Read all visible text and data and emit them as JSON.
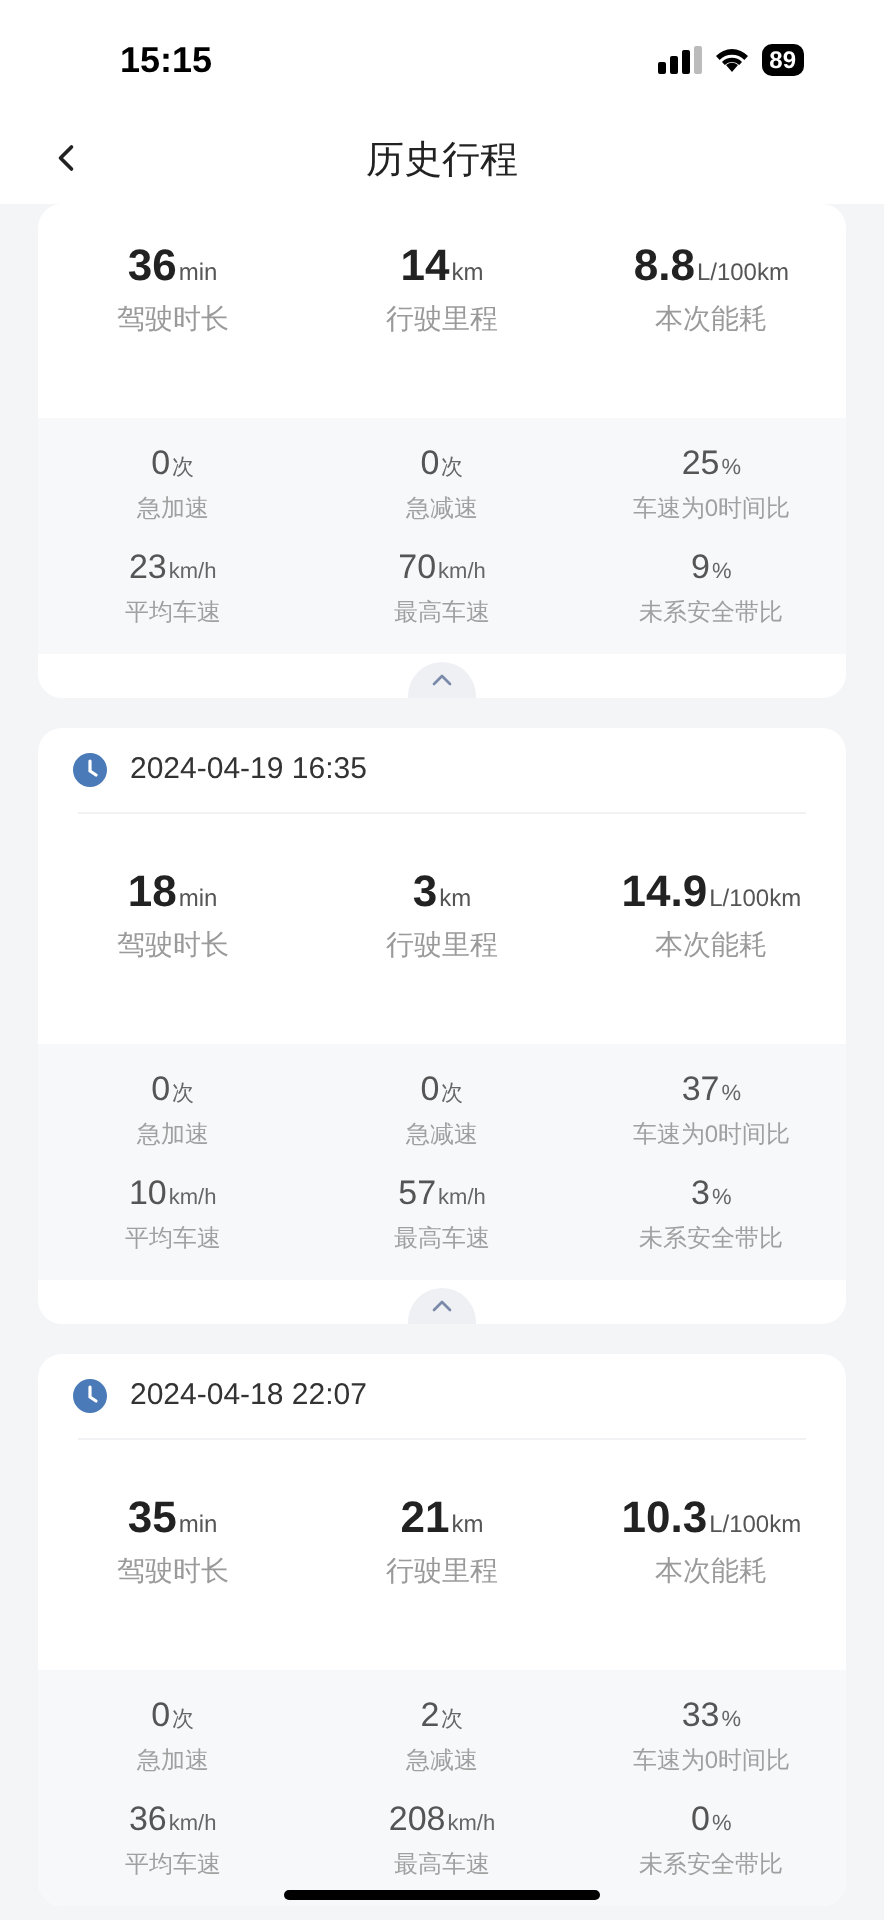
{
  "status_bar": {
    "time": "15:15",
    "battery": "89"
  },
  "nav": {
    "title": "历史行程"
  },
  "trips": [
    {
      "primary": [
        {
          "value": "36",
          "unit": "min",
          "label": "驾驶时长"
        },
        {
          "value": "14",
          "unit": "km",
          "label": "行驶里程"
        },
        {
          "value": "8.8",
          "unit": "L/100km",
          "label": "本次能耗"
        }
      ],
      "secondary": [
        {
          "value": "0",
          "unit": "次",
          "label": "急加速"
        },
        {
          "value": "0",
          "unit": "次",
          "label": "急减速"
        },
        {
          "value": "25",
          "unit": "%",
          "label": "车速为0时间比"
        },
        {
          "value": "23",
          "unit": "km/h",
          "label": "平均车速"
        },
        {
          "value": "70",
          "unit": "km/h",
          "label": "最高车速"
        },
        {
          "value": "9",
          "unit": "%",
          "label": "未系安全带比"
        }
      ],
      "expanded": true
    },
    {
      "date": "2024-04-19 16:35",
      "primary": [
        {
          "value": "18",
          "unit": "min",
          "label": "驾驶时长"
        },
        {
          "value": "3",
          "unit": "km",
          "label": "行驶里程"
        },
        {
          "value": "14.9",
          "unit": "L/100km",
          "label": "本次能耗"
        }
      ],
      "secondary": [
        {
          "value": "0",
          "unit": "次",
          "label": "急加速"
        },
        {
          "value": "0",
          "unit": "次",
          "label": "急减速"
        },
        {
          "value": "37",
          "unit": "%",
          "label": "车速为0时间比"
        },
        {
          "value": "10",
          "unit": "km/h",
          "label": "平均车速"
        },
        {
          "value": "57",
          "unit": "km/h",
          "label": "最高车速"
        },
        {
          "value": "3",
          "unit": "%",
          "label": "未系安全带比"
        }
      ],
      "expanded": true
    },
    {
      "date": "2024-04-18 22:07",
      "primary": [
        {
          "value": "35",
          "unit": "min",
          "label": "驾驶时长"
        },
        {
          "value": "21",
          "unit": "km",
          "label": "行驶里程"
        },
        {
          "value": "10.3",
          "unit": "L/100km",
          "label": "本次能耗"
        }
      ],
      "secondary": [
        {
          "value": "0",
          "unit": "次",
          "label": "急加速"
        },
        {
          "value": "2",
          "unit": "次",
          "label": "急减速"
        },
        {
          "value": "33",
          "unit": "%",
          "label": "车速为0时间比"
        },
        {
          "value": "36",
          "unit": "km/h",
          "label": "平均车速"
        },
        {
          "value": "208",
          "unit": "km/h",
          "label": "最高车速"
        },
        {
          "value": "0",
          "unit": "%",
          "label": "未系安全带比"
        }
      ]
    }
  ]
}
